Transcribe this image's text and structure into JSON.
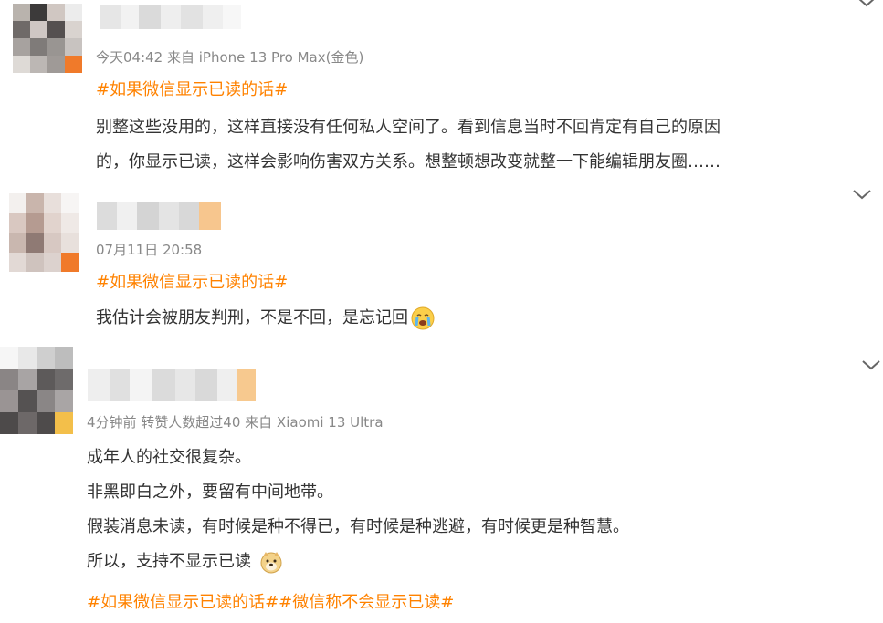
{
  "comments": [
    {
      "meta": "今天04:42  来自 iPhone 13 Pro Max(金色)",
      "hashtag": "#如果微信显示已读的话#",
      "lines": [
        "别整这些没用的，这样直接没有任何私人空间了。看到信息当时不回肯定有自己的原因",
        "的，你显示已读，这样会影响伤害双方关系。想整顿想改变就整一下能编辑朋友圈……"
      ]
    },
    {
      "meta": "07月11日 20:58",
      "hashtag": "#如果微信显示已读的话#",
      "lines": [
        "我估计会被朋友判刑，不是不回，是忘记回"
      ],
      "emoji": "crying-face-icon"
    },
    {
      "meta": "4分钟前 转赞人数超过40  来自 Xiaomi 13 Ultra",
      "lines": [
        "成年人的社交很复杂。",
        "非黑即白之外，要留有中间地带。",
        "假装消息未读，有时候是种不得已，有时候是种逃避，有时候更是种智慧。",
        "所以，支持不显示已读"
      ],
      "emoji": "doge-icon",
      "hashtags": "#如果微信显示已读的话##微信称不会显示已读#"
    }
  ],
  "colors": {
    "hashtag": "#ff8200",
    "meta": "#888888",
    "text": "#333333",
    "chevron": "#666666"
  }
}
